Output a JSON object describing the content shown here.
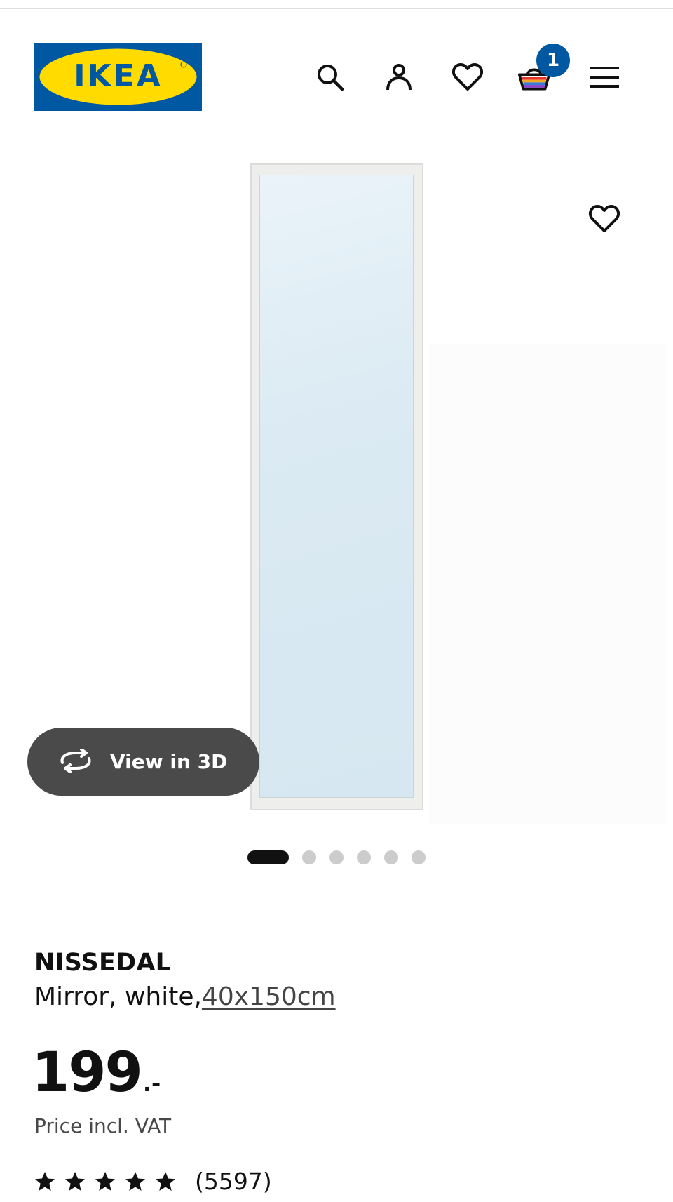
{
  "header": {
    "logo_text": "IKEA",
    "cart_count": "1"
  },
  "product_image": {
    "view_3d_label": "View in 3D",
    "image_count": 6,
    "active_image": 1
  },
  "product": {
    "name": "NISSEDAL",
    "description": "Mirror, white,",
    "size": "40x150cm",
    "price": "199",
    "price_suffix": ".-",
    "price_note": "Price incl. VAT",
    "rating_stars": 5,
    "rating_count": "(5597)"
  },
  "colors": {
    "brand_blue": "#0058a3",
    "brand_yellow": "#ffdb00",
    "pill_bg": "#4a4a4a"
  },
  "icons": [
    "search-icon",
    "user-icon",
    "heart-icon",
    "cart-icon",
    "menu-icon",
    "rotate-icon",
    "star-icon"
  ]
}
